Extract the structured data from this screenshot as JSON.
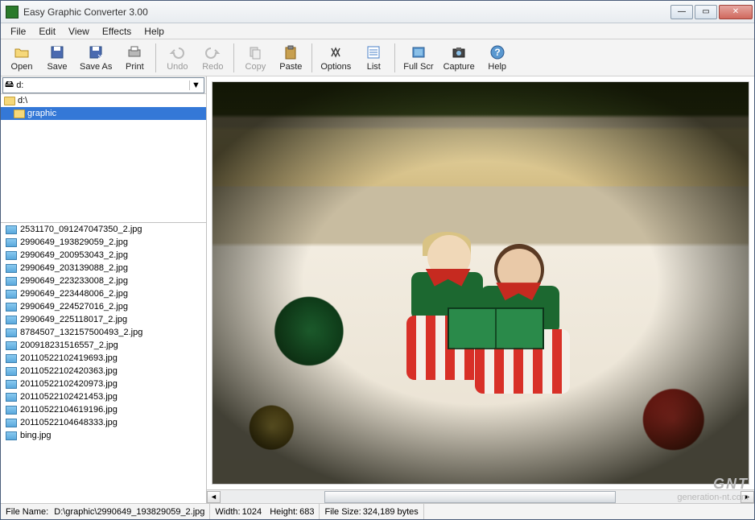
{
  "window": {
    "title": "Easy Graphic Converter 3.00"
  },
  "menu": {
    "file": "File",
    "edit": "Edit",
    "view": "View",
    "effects": "Effects",
    "help": "Help"
  },
  "toolbar": {
    "open": "Open",
    "save": "Save",
    "saveas": "Save As",
    "print": "Print",
    "undo": "Undo",
    "redo": "Redo",
    "copy": "Copy",
    "paste": "Paste",
    "options": "Options",
    "list": "List",
    "fullscr": "Full Scr",
    "capture": "Capture",
    "help": "Help"
  },
  "drive": {
    "label": "d:"
  },
  "tree": {
    "root": "d:\\",
    "folder": "graphic"
  },
  "files": [
    "2531170_091247047350_2.jpg",
    "2990649_193829059_2.jpg",
    "2990649_200953043_2.jpg",
    "2990649_203139088_2.jpg",
    "2990649_223233008_2.jpg",
    "2990649_223448006_2.jpg",
    "2990649_224527016_2.jpg",
    "2990649_225118017_2.jpg",
    "8784507_132157500493_2.jpg",
    "200918231516557_2.jpg",
    "20110522102419693.jpg",
    "20110522102420363.jpg",
    "20110522102420973.jpg",
    "20110522102421453.jpg",
    "20110522104619196.jpg",
    "20110522104648333.jpg",
    "bing.jpg"
  ],
  "status": {
    "filename_label": "File Name:",
    "filename": "D:\\graphic\\2990649_193829059_2.jpg",
    "width_label": "Width:",
    "width": "1024",
    "height_label": "Height:",
    "height": "683",
    "size_label": "File Size:",
    "size": "324,189 bytes"
  },
  "watermark": {
    "big": "GNT",
    "small": "generation-nt.com"
  }
}
